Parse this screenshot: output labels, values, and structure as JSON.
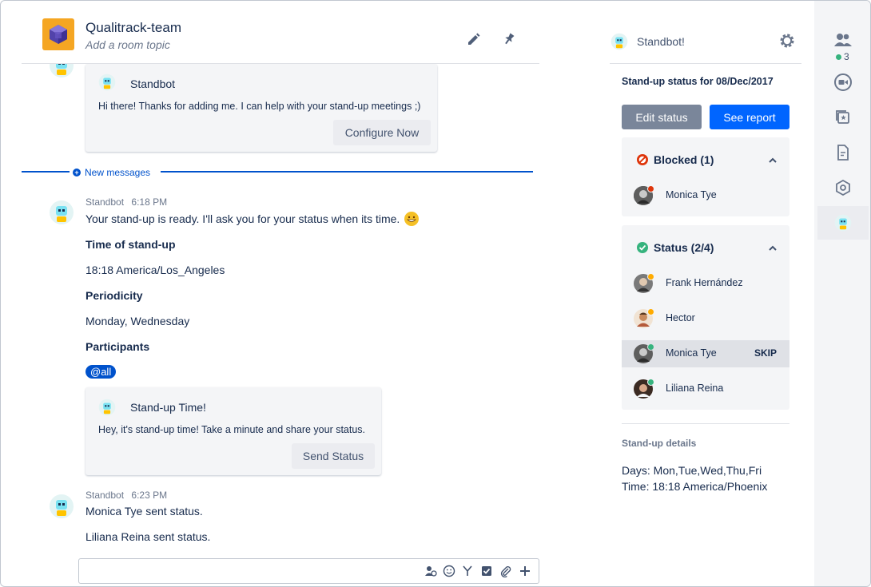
{
  "header": {
    "room_name": "Qualitrack-team",
    "room_topic": "Add a room topic",
    "icons": [
      "pencil-icon",
      "pin-icon"
    ]
  },
  "chat": {
    "intro_card": {
      "bot_name": "Standbot",
      "text": "Hi there! Thanks for adding me. I can help with your stand-up meetings ;)",
      "button": "Configure Now"
    },
    "new_messages_label": "New messages",
    "message1": {
      "author": "Standbot",
      "time": "6:18 PM",
      "text": "Your stand-up is ready. I'll ask you for your status when its time.",
      "heading_time": "Time of stand-up",
      "time_value": "18:18 America/Los_Angeles",
      "heading_periodicity": "Periodicity",
      "periodicity_value": "Monday, Wednesday",
      "heading_participants": "Participants",
      "mention": "@all"
    },
    "standup_card": {
      "bot_name": "Stand-up Time!",
      "text": "Hey, it's stand-up time! Take a minute and share your status.",
      "button": "Send Status"
    },
    "message2": {
      "author": "Standbot",
      "time": "6:23 PM",
      "line1": "Monica Tye sent status.",
      "line2": "Liliana Reina sent status."
    }
  },
  "composer": {
    "icons": [
      "mention-icon",
      "emoji-icon",
      "merge-icon",
      "checkbox-icon",
      "attachment-icon",
      "plus-icon"
    ]
  },
  "right_panel": {
    "title": "Standbot!",
    "status_date": "Stand-up status for 08/Dec/2017",
    "edit_button": "Edit status",
    "report_button": "See report",
    "blocked": {
      "label": "Blocked (1)",
      "people": [
        {
          "name": "Monica Tye"
        }
      ]
    },
    "status": {
      "label": "Status (2/4)",
      "people": [
        {
          "name": "Frank Hernández",
          "badge": "pending"
        },
        {
          "name": "Hector",
          "badge": "pending"
        },
        {
          "name": "Monica Tye",
          "badge": "done",
          "tag": "SKIP"
        },
        {
          "name": "Liliana Reina",
          "badge": "done"
        }
      ]
    },
    "details_heading": "Stand-up details",
    "days": "Days: Mon,Tue,Wed,Thu,Fri",
    "time": "Time: 18:18 America/Phoenix"
  },
  "sidebar": {
    "participants_count": "3",
    "icons": [
      "people-icon",
      "video-icon",
      "starred-icon",
      "file-icon",
      "integrations-icon",
      "standbot-icon"
    ]
  },
  "colors": {
    "primary": "#0052cc",
    "button_blue": "#0065ff",
    "button_grey": "#7a869a",
    "blocked": "#de350b",
    "ok": "#36b37e",
    "pending": "#ffab00"
  }
}
